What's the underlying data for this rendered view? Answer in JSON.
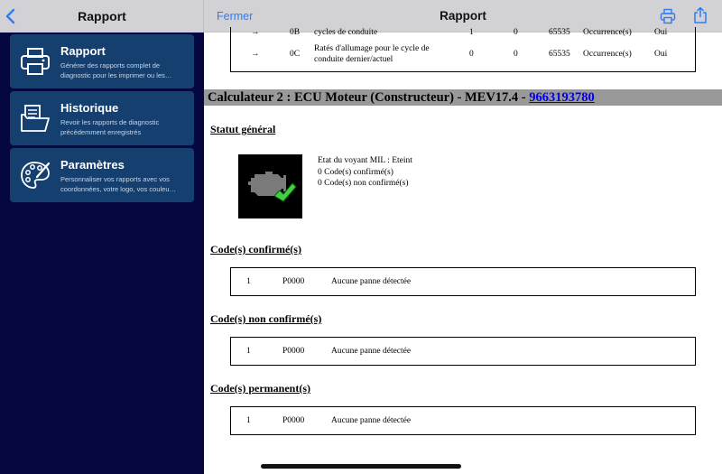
{
  "sidebar": {
    "title": "Rapport",
    "items": [
      {
        "title": "Rapport",
        "description": "Générer des rapports complet de diagnostic pour les imprimer ou les…",
        "icon": "printer-icon"
      },
      {
        "title": "Historique",
        "description": "Revoir les rapports de diagnostic précédemment enregistrés",
        "icon": "history-folder-icon"
      },
      {
        "title": "Paramètres",
        "description": "Personnaliser vos rapports avec vos coordonnées, votre logo, vos couleu…",
        "icon": "palette-icon"
      }
    ]
  },
  "header": {
    "close_label": "Fermer",
    "title": "Rapport"
  },
  "document": {
    "top_table_rows": [
      {
        "arrow": "→",
        "code": "0B",
        "description": "cycles de conduite",
        "v1": "1",
        "v2": "0",
        "v3": "65535",
        "occurrence": "Occurrence(s)",
        "flag": "Oui"
      },
      {
        "arrow": "→",
        "code": "0C",
        "description": "Ratés d'allumage pour le cycle de conduite dernier/actuel",
        "v1": "0",
        "v2": "0",
        "v3": "65535",
        "occurrence": "Occurrence(s)",
        "flag": "Oui"
      }
    ],
    "ecu_heading": "Calculateur 2 : ECU Moteur (Constructeur) - MEV17.4 - ",
    "ecu_link": "9663193780",
    "general_status_title": "Statut général",
    "status_lines": [
      "Etat du voyant MIL : Eteint",
      "0 Code(s) confirmé(s)",
      "0 Code(s) non confirmé(s)"
    ],
    "sections": [
      {
        "title": "Code(s) confirmé(s)",
        "row": {
          "num": "1",
          "code": "P0000",
          "desc": "Aucune panne détectée"
        }
      },
      {
        "title": "Code(s) non confirmé(s)",
        "row": {
          "num": "1",
          "code": "P0000",
          "desc": "Aucune panne détectée"
        }
      },
      {
        "title": "Code(s) permanent(s)",
        "row": {
          "num": "1",
          "code": "P0000",
          "desc": "Aucune panne détectée"
        }
      }
    ]
  },
  "colors": {
    "sidebar_bg": "#050840",
    "card_bg": "#153f6f",
    "accent": "#2d7cf6",
    "link": "#0000ee",
    "check": "#3fd13f"
  }
}
